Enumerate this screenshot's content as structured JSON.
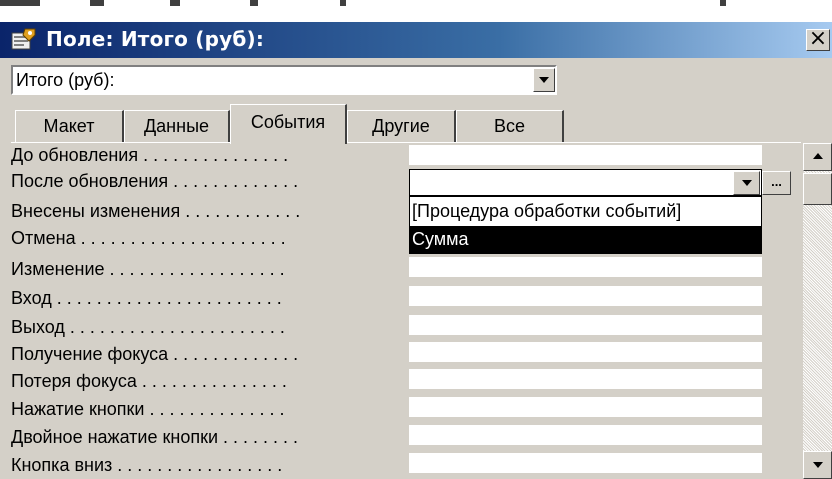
{
  "window": {
    "title": "Поле: Итого (руб):",
    "close_glyph": "×"
  },
  "object_selector": {
    "value": "Итого (руб):"
  },
  "tabs": [
    {
      "label": "Макет",
      "active": false
    },
    {
      "label": "Данные",
      "active": false
    },
    {
      "label": "События",
      "active": true
    },
    {
      "label": "Другие",
      "active": false
    },
    {
      "label": "Все",
      "active": false
    }
  ],
  "properties": [
    {
      "label": "До обновления . . . . . . . . . . . . . . ."
    },
    {
      "label": "После обновления . . . . . . . . . . . . ."
    },
    {
      "label": "Внесены изменения . . . . . . . . . . . ."
    },
    {
      "label": "Отмена . . . . . . . . . . . . . . . . . . . . ."
    },
    {
      "label": "Изменение . . . . . . . . . . . . . . . . . ."
    },
    {
      "label": "Вход . . . . . . . . . . . . . . . . . . . . . . ."
    },
    {
      "label": "Выход . . . . . . . . . . . . . . . . . . . . . ."
    },
    {
      "label": "Получение фокуса . . . . . . . . . . . . ."
    },
    {
      "label": "Потеря фокуса . . . . . . . . . . . . . . ."
    },
    {
      "label": "Нажатие кнопки . . . . . . . . . . . . . ."
    },
    {
      "label": "Двойное нажатие кнопки . . . . . . . ."
    },
    {
      "label": "Кнопка вниз . . . . . . . . . . . . . . . . ."
    }
  ],
  "dropdown": {
    "row": "После обновления",
    "builder_label": "...",
    "options": [
      {
        "label": "[Процедура обработки событий]",
        "selected": false
      },
      {
        "label": "Сумма",
        "selected": true
      }
    ]
  },
  "colors": {
    "title_gradient_start": "#0a246a",
    "title_gradient_end": "#a6caf0",
    "face": "#d4d0c8",
    "selection": "#000000"
  }
}
